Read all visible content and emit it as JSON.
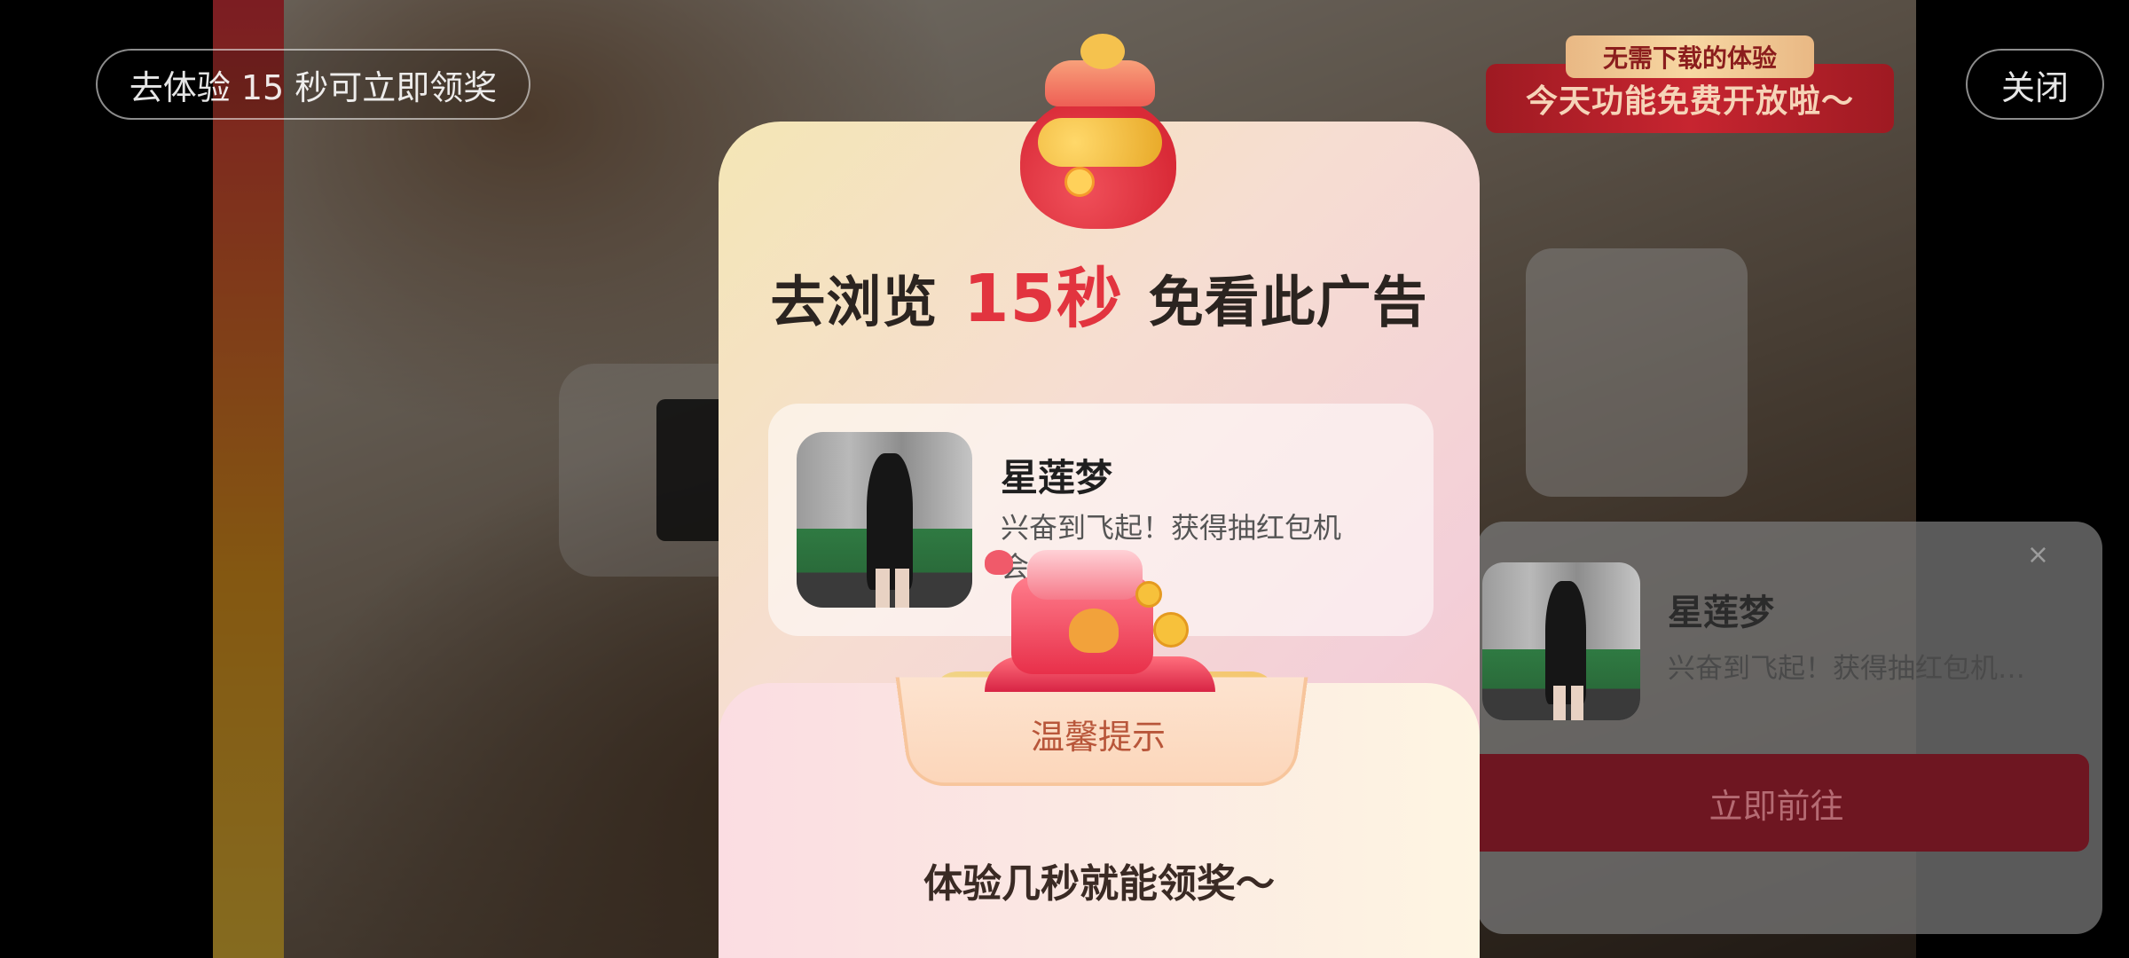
{
  "top_bar": {
    "trial_pill": "去体验 15 秒可立即领奖",
    "close_button": "关闭"
  },
  "promo_banner": {
    "tag": "无需下载的体验",
    "main": "今天功能免费开放啦～"
  },
  "modal": {
    "headline_prefix": "去浏览",
    "headline_highlight": "15秒",
    "headline_suffix": "免看此广告",
    "app_name": "星莲梦",
    "app_desc": "兴奋到飞起！获得抽红包机会…棚啦"
  },
  "tip": {
    "title": "温馨提示",
    "message": "体验几秒就能领奖～"
  },
  "side_card": {
    "close": "×",
    "app_name": "星莲梦",
    "app_desc": "兴奋到飞起！获得抽红包机…",
    "cta": "立即前往"
  },
  "colors": {
    "accent_red": "#e2343f",
    "cta_dark_red": "#6e1621",
    "tip_text": "#b8563a"
  },
  "icons": [
    "lucky-jar-icon",
    "gift-box-icon",
    "app-thumbnail"
  ]
}
